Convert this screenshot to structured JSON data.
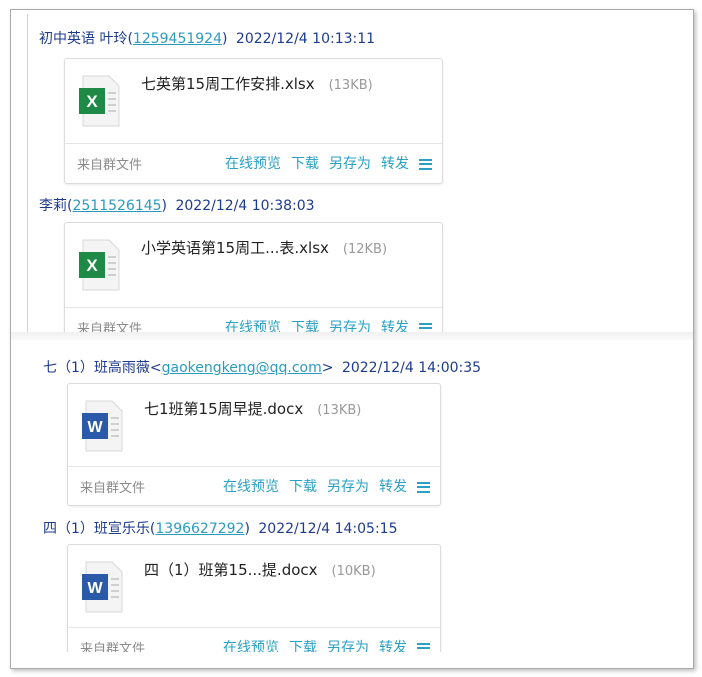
{
  "messages": [
    {
      "sender": "初中英语 叶玲(",
      "contact": "1259451924",
      "close": ")",
      "time": "2022/12/4 10:13:11",
      "file_name": "七英第15周工作安排.xlsx",
      "file_size": "(13KB)",
      "file_icon": "excel-icon"
    },
    {
      "sender": "李莉(",
      "contact": "2511526145",
      "close": ")",
      "time": "2022/12/4 10:38:03",
      "file_name": "小学英语第15周工...表.xlsx",
      "file_size": "(12KB)",
      "file_icon": "excel-icon"
    },
    {
      "sender": "七（1）班高雨薇<",
      "contact": "gaokengkeng@qq.com",
      "close": ">",
      "time": "2022/12/4 14:00:35",
      "file_name": "七1班第15周早提.docx",
      "file_size": "(13KB)",
      "file_icon": "word-icon"
    },
    {
      "sender": "四（1）班宣乐乐(",
      "contact": "1396627292",
      "close": ")",
      "time": "2022/12/4 14:05:15",
      "file_name": "四（1）班第15...提.docx",
      "file_size": "(10KB)",
      "file_icon": "word-icon"
    }
  ],
  "card_actions": {
    "source": "来自群文件",
    "preview": "在线预览",
    "download": "下载",
    "save_as": "另存为",
    "forward": "转发",
    "menu_icon": "hamburger-menu-icon"
  },
  "colors": {
    "header_text": "#1f3b8c",
    "link": "#2a9bbd",
    "action": "#2aa1c4",
    "excel_green": "#1f8a45",
    "word_blue": "#2b5aa8"
  }
}
